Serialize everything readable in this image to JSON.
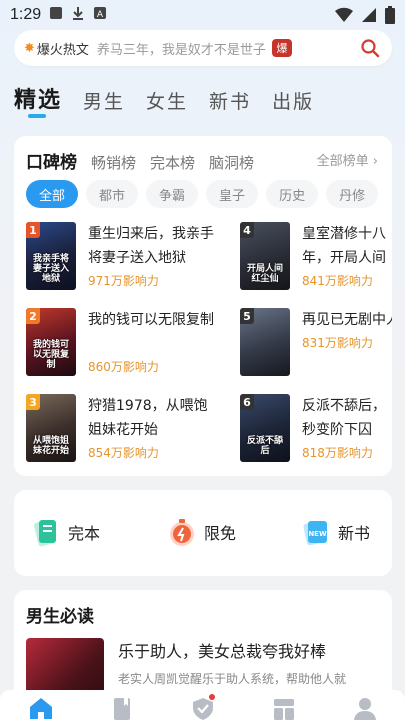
{
  "status_bar": {
    "time": "1:29"
  },
  "search": {
    "hot_label": "爆火热文",
    "placeholder": "养马三年，我是奴才不是世子",
    "badge": "爆"
  },
  "top_tabs": [
    "精选",
    "男生",
    "女生",
    "新书",
    "出版"
  ],
  "ranking": {
    "tabs": [
      "口碑榜",
      "畅销榜",
      "完本榜",
      "脑洞榜"
    ],
    "all_label": "全部榜单 ›",
    "chips": [
      "全部",
      "都市",
      "争霸",
      "皇子",
      "历史",
      "丹修"
    ],
    "books": [
      {
        "rank": "1",
        "title": "重生归来后，我亲手将妻子送入地狱",
        "influence": "971万影响力",
        "cover_text": "我亲手将妻子送入地狱",
        "badge_color": "#e8542a"
      },
      {
        "rank": "2",
        "title": "我的钱可以无限复制",
        "influence": "860万影响力",
        "cover_text": "我的钱可以无限复制",
        "badge_color": "#f07a2a"
      },
      {
        "rank": "3",
        "title": "狩猎1978，从喂饱姐妹花开始",
        "influence": "854万影响力",
        "cover_text": "从喂饱姐妹花开始",
        "badge_color": "#f5a623"
      },
      {
        "rank": "4",
        "title": "皇室潜修十八年，开局人间红尘",
        "influence": "841万影响力",
        "cover_text": "开局人间红尘仙",
        "badge_color": "#333333"
      },
      {
        "rank": "5",
        "title": "再见已无剧中人",
        "influence": "831万影响力",
        "cover_text": "",
        "badge_color": "#333333"
      },
      {
        "rank": "6",
        "title": "反派不舔后，秒变阶下囚",
        "influence": "818万影响力",
        "cover_text": "反派不舔后",
        "badge_color": "#333333"
      }
    ]
  },
  "shortcuts": [
    {
      "label": "完本",
      "icon": "book-complete-icon"
    },
    {
      "label": "限免",
      "icon": "timer-free-icon"
    },
    {
      "label": "新书",
      "icon": "new-book-icon"
    }
  ],
  "boys_read": {
    "title": "男生必读",
    "book_title": "乐于助人，美女总裁夸我好棒",
    "book_desc": "老实人周凯觉醒乐于助人系统，帮助他人就"
  },
  "bottom_nav": [
    "home-icon",
    "bookshelf-icon",
    "welfare-icon",
    "category-icon",
    "profile-icon"
  ]
}
